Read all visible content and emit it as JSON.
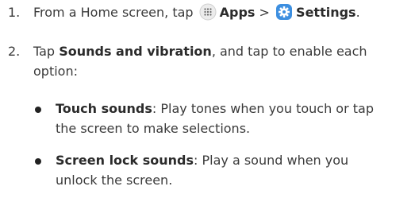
{
  "steps": [
    {
      "number": "1.",
      "prefix": "From a Home screen, tap",
      "apps_label": "Apps",
      "separator": ">",
      "settings_label": "Settings",
      "suffix": "."
    },
    {
      "number": "2.",
      "prefix": "Tap",
      "bold": "Sounds and vibration",
      "line1_rest": ", and tap to enable each",
      "line2": "option:"
    }
  ],
  "options": [
    {
      "name": "Touch sounds",
      "line1": ": Play tones when you touch or tap",
      "line2": "the screen to make selections."
    },
    {
      "name": "Screen lock sounds",
      "line1": ": Play a sound when you",
      "line2": "unlock the screen."
    }
  ],
  "icons": {
    "apps": "apps-grid-icon",
    "settings": "settings-gear-icon",
    "settings_color": "#3d8fe0",
    "apps_color": "#e9e9e9"
  }
}
